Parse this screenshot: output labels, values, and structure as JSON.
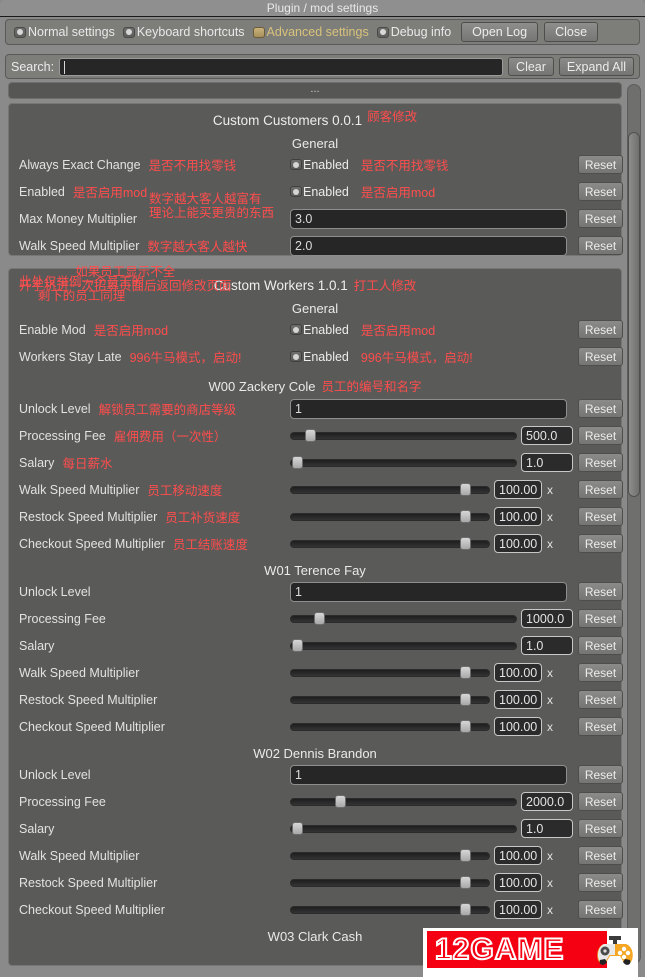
{
  "window": {
    "title": "Plugin / mod settings"
  },
  "toolbar": {
    "tabs": [
      {
        "label": "Normal settings",
        "selected": false
      },
      {
        "label": "Keyboard shortcuts",
        "selected": false
      },
      {
        "label": "Advanced settings",
        "selected": true
      },
      {
        "label": "Debug info",
        "selected": false
      }
    ],
    "open_log_label": "Open Log",
    "close_label": "Close"
  },
  "search": {
    "label": "Search:",
    "value": "",
    "placeholder": "",
    "clear_label": "Clear",
    "expand_all_label": "Expand All"
  },
  "separator": {
    "text": "..."
  },
  "reset_label": "Reset",
  "enabled_label": "Enabled",
  "x_label": "x",
  "colors": {
    "accent_selected_tab": "#d9c27a",
    "annotation_red": "#ff4d4d",
    "panel_bg": "#5a5a58",
    "window_bg": "#8a8a8a",
    "field_bg": "#262626"
  },
  "mods": [
    {
      "name": "Custom Customers 0.0.1",
      "name_annotation": "顾客修改",
      "section": "General",
      "rows": [
        {
          "label": "Always Exact Change",
          "type": "checkbox",
          "value": "Enabled",
          "annotation": "是否不用找零钱"
        },
        {
          "label": "Enabled",
          "type": "checkbox",
          "value": "Enabled",
          "annotation": "是否启用mod"
        },
        {
          "label": "Max Money Multiplier",
          "type": "text",
          "value": "3.0",
          "annotation": "数字越大客人越富有\n理论上能买更贵的东西",
          "annotation_inline": true
        },
        {
          "label": "Walk Speed Multiplier",
          "type": "text",
          "value": "2.0",
          "annotation": "数字越大客人越快"
        }
      ]
    },
    {
      "name": "Custom Workers 1.0.1",
      "name_annotation": "打工人修改",
      "top_left_annotation": "此处仅举例一个员工的\n剩下的员工同理",
      "section": "General",
      "general_rows": [
        {
          "label": "Enable Mod",
          "type": "checkbox",
          "value": "Enabled",
          "annotation": "是否启用mod"
        },
        {
          "label": "Workers Stay Late",
          "type": "checkbox",
          "value": "Enabled",
          "annotation": "996牛马模式，启动!"
        }
      ],
      "workers": [
        {
          "title": "W00 Zackery Cole",
          "title_annotation": "员工的编号和名字",
          "pre_annotation": "如果员工显示不全\n开手机进一次招募页面后返回修改页面",
          "rows": [
            {
              "label": "Unlock Level",
              "type": "text",
              "value": "1",
              "annotation": "解锁员工需要的商店等级"
            },
            {
              "label": "Processing Fee",
              "type": "slider",
              "value": "500.0",
              "pos": 0.07,
              "annotation": "雇佣费用（一次性）"
            },
            {
              "label": "Salary",
              "type": "slider",
              "value": "1.0",
              "pos": 0.01,
              "annotation": "每日薪水"
            },
            {
              "label": "Walk Speed Multiplier",
              "type": "slider-mult",
              "value": "100.00",
              "pos": 0.9,
              "annotation": "员工移动速度"
            },
            {
              "label": "Restock Speed Multiplier",
              "type": "slider-mult",
              "value": "100.00",
              "pos": 0.9,
              "annotation": "员工补货速度"
            },
            {
              "label": "Checkout Speed Multiplier",
              "type": "slider-mult",
              "value": "100.00",
              "pos": 0.9,
              "annotation": "员工结账速度"
            }
          ]
        },
        {
          "title": "W01 Terence Fay",
          "rows": [
            {
              "label": "Unlock Level",
              "type": "text",
              "value": "1"
            },
            {
              "label": "Processing Fee",
              "type": "slider",
              "value": "1000.0",
              "pos": 0.11
            },
            {
              "label": "Salary",
              "type": "slider",
              "value": "1.0",
              "pos": 0.01
            },
            {
              "label": "Walk Speed Multiplier",
              "type": "slider-mult",
              "value": "100.00",
              "pos": 0.9
            },
            {
              "label": "Restock Speed Multiplier",
              "type": "slider-mult",
              "value": "100.00",
              "pos": 0.9
            },
            {
              "label": "Checkout Speed Multiplier",
              "type": "slider-mult",
              "value": "100.00",
              "pos": 0.9
            }
          ]
        },
        {
          "title": "W02 Dennis Brandon",
          "rows": [
            {
              "label": "Unlock Level",
              "type": "text",
              "value": "1"
            },
            {
              "label": "Processing Fee",
              "type": "slider",
              "value": "2000.0",
              "pos": 0.21
            },
            {
              "label": "Salary",
              "type": "slider",
              "value": "1.0",
              "pos": 0.01
            },
            {
              "label": "Walk Speed Multiplier",
              "type": "slider-mult",
              "value": "100.00",
              "pos": 0.9
            },
            {
              "label": "Restock Speed Multiplier",
              "type": "slider-mult",
              "value": "100.00",
              "pos": 0.9
            },
            {
              "label": "Checkout Speed Multiplier",
              "type": "slider-mult",
              "value": "100.00",
              "pos": 0.9
            }
          ]
        },
        {
          "title": "W03 Clark Cash",
          "rows": []
        }
      ]
    }
  ],
  "watermark": {
    "text": "12GAME"
  }
}
